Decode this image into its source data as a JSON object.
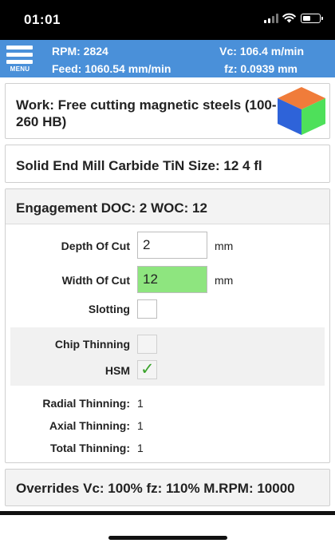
{
  "status": {
    "time": "01:01"
  },
  "header": {
    "menu_label": "MENU",
    "rpm": "RPM: 2824",
    "feed": "Feed: 1060.54 mm/min",
    "vc": "Vc: 106.4 m/min",
    "fz": "fz: 0.0939 mm",
    "color": "#4a90d9"
  },
  "work": {
    "line1": "Work: Free cutting magnetic steels (100-",
    "line2": "260 HB)",
    "cube_icon": "material-cube-icon"
  },
  "tool": {
    "title": "Solid End Mill Carbide TiN Size: 12 4 fl"
  },
  "engagement": {
    "title": "Engagement DOC: 2 WOC: 12",
    "depth_label": "Depth Of Cut",
    "depth_value": "2",
    "depth_unit": "mm",
    "width_label": "Width Of Cut",
    "width_value": "12",
    "width_unit": "mm",
    "width_highlight": "#8ee57f",
    "slotting_label": "Slotting",
    "slotting_checked": false,
    "chip_thinning_label": "Chip Thinning",
    "chip_thinning_checked": false,
    "hsm_label": "HSM",
    "hsm_checked": true,
    "hsm_mark": "✓",
    "radial_label": "Radial Thinning:",
    "radial_value": "1",
    "axial_label": "Axial Thinning:",
    "axial_value": "1",
    "total_label": "Total Thinning:",
    "total_value": "1"
  },
  "overrides": {
    "title": "Overrides Vc: 100% fz: 110% M.RPM: 10000"
  }
}
